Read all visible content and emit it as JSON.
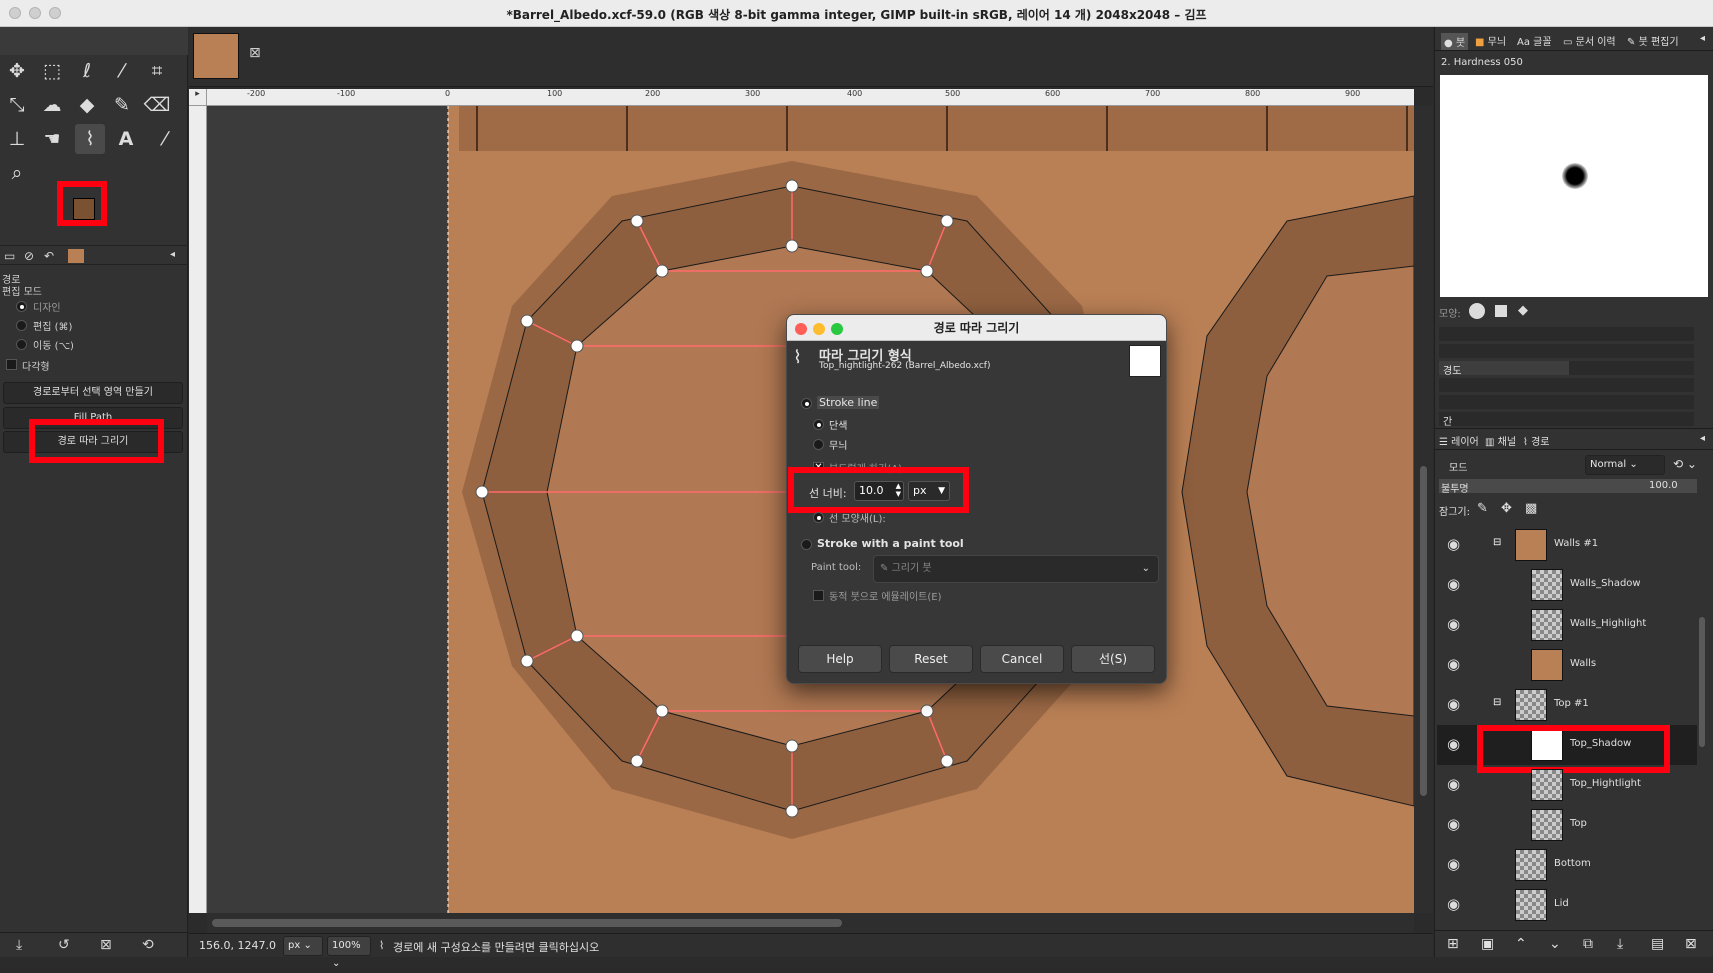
{
  "window": {
    "title": "*Barrel_Albedo.xcf-59.0 (RGB 색상 8-bit gamma integer, GIMP built-in sRGB, 레이어 14 개) 2048x2048 – 김프"
  },
  "toolbox": {
    "tools": [
      "move-icon",
      "rect-select-icon",
      "lasso-icon",
      "fuzzy-select-icon",
      "crop-icon",
      "transform-icon",
      "warp-icon",
      "bucket-fill-icon",
      "paintbrush-icon",
      "eraser-icon",
      "clone-icon",
      "smudge-icon",
      "paths-tool-icon",
      "text-icon",
      "color-picker-icon",
      "zoom-icon"
    ],
    "fg_color": "#7a5232",
    "bg_color": "#ffffff"
  },
  "tool_options": {
    "section_title": "경로",
    "edit_mode_label": "편집 모드",
    "modes": [
      "디자인",
      "편집 (⌘)",
      "이동 (⌥)"
    ],
    "polygon_label": "다각형",
    "btn_selection": "경로로부터 선택 영역 만들기",
    "btn_fill": "Fill Path",
    "btn_stroke": "경로 따라 그리기"
  },
  "ruler": {
    "marks": [
      "-200",
      "-100",
      "0",
      "100",
      "200",
      "300",
      "400",
      "500",
      "600",
      "700",
      "800",
      "900"
    ]
  },
  "dialog": {
    "title": "경로 따라 그리기",
    "header_title": "따라 그리기 형식",
    "header_sub": "Top_hightlight-262 (Barrel_Albedo.xcf)",
    "stroke_line": "Stroke line",
    "solid": "단색",
    "pattern": "무늬",
    "antialias": "부드럽게 하기(A)",
    "line_width_label": "선 너비:",
    "line_width_value": "10.0",
    "unit": "px",
    "line_style": "선 모양새(L):",
    "paint_tool_option": "Stroke with a paint tool",
    "paint_tool_label": "Paint tool:",
    "paint_tool_value": "그리기 붓",
    "emulate": "동적 붓으로 에뮬레이트(E)",
    "buttons": {
      "help": "Help",
      "reset": "Reset",
      "cancel": "Cancel",
      "stroke": "선(S)"
    }
  },
  "brushes": {
    "tabs": [
      "붓",
      "무늬",
      "글꼴",
      "문서 이력",
      "붓 편집기"
    ],
    "current": "2. Hardness 050",
    "shape_label": "모양:",
    "hardness_label": "경도",
    "extra_label": "간"
  },
  "layers": {
    "tabs": [
      "레이어",
      "채널",
      "경로"
    ],
    "mode_label": "모드",
    "mode_value": "Normal",
    "opacity_label": "불투명",
    "opacity_value": "100.0",
    "lock_label": "잠그기:",
    "items": [
      {
        "name": "Walls #1",
        "group": true
      },
      {
        "name": "Walls_Shadow"
      },
      {
        "name": "Walls_Highlight"
      },
      {
        "name": "Walls"
      },
      {
        "name": "Top #1",
        "group": true
      },
      {
        "name": "Top_Shadow"
      },
      {
        "name": "Top_Hightlight"
      },
      {
        "name": "Top"
      },
      {
        "name": "Bottom"
      },
      {
        "name": "Lid"
      }
    ]
  },
  "status": {
    "coords": "156.0, 1247.0",
    "unit": "px",
    "zoom": "100%",
    "message": "경로에 새 구성요소를 만들려면 클릭하십시오"
  },
  "colors": {
    "highlight_red": "#ff0010",
    "wood": "#b97f55",
    "wood_dark": "#8e5f3e"
  }
}
